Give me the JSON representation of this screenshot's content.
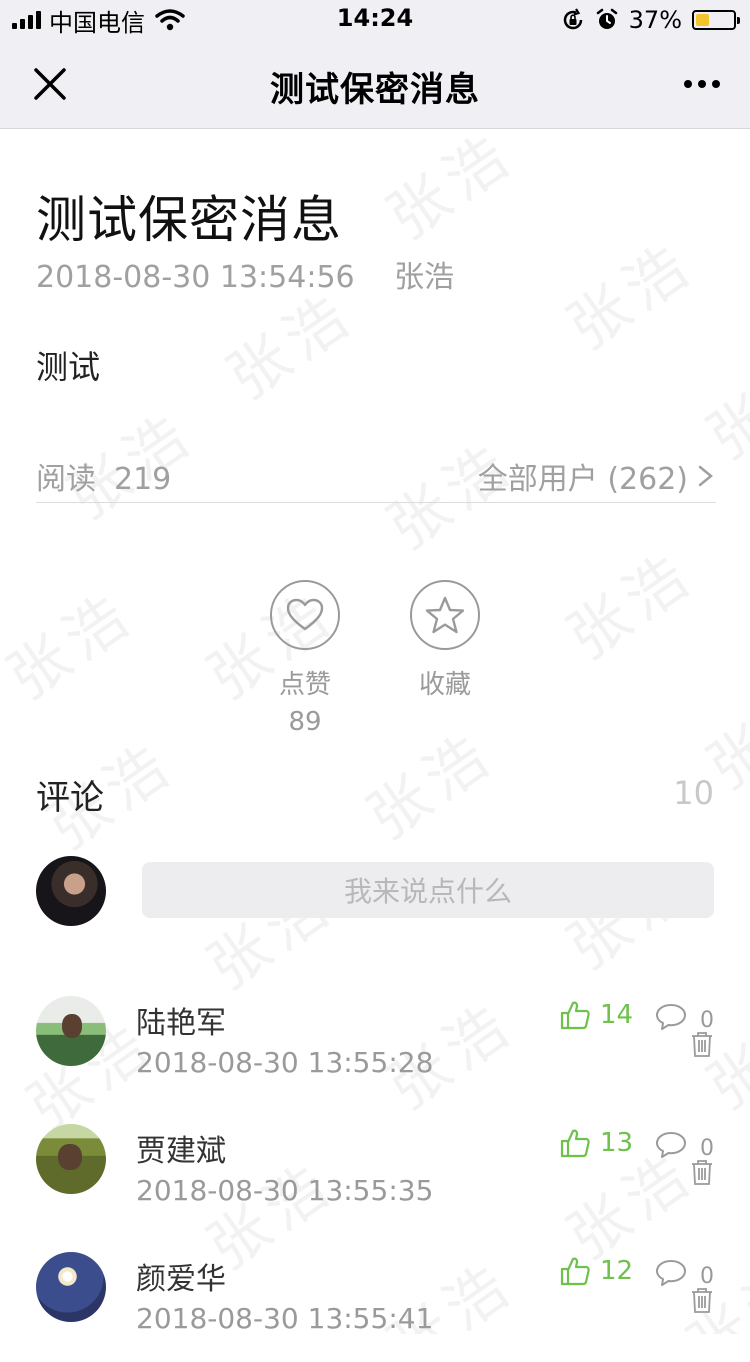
{
  "status_bar": {
    "carrier": "中国电信",
    "time": "14:24",
    "battery_percent": "37%",
    "battery_level": 0.37,
    "battery_color": "#f4c430"
  },
  "nav": {
    "title": "测试保密消息",
    "close_icon": "close-icon",
    "more_icon": "more-icon"
  },
  "watermark": "张浩",
  "article": {
    "title": "测试保密消息",
    "date": "2018-08-30 13:54:56",
    "author": "张浩",
    "body": "测试"
  },
  "read_row": {
    "label": "阅读",
    "count": "219",
    "audience": "全部用户 (262)"
  },
  "actions": {
    "like_label": "点赞",
    "like_count": "89",
    "favorite_label": "收藏"
  },
  "comments": {
    "header": "评论",
    "count": "10",
    "input_placeholder": "我来说点什么",
    "items": [
      {
        "name": "陆艳军",
        "time": "2018-08-30 13:55:28",
        "likes": "14",
        "replies": "0"
      },
      {
        "name": "贾建斌",
        "time": "2018-08-30 13:55:35",
        "likes": "13",
        "replies": "0"
      },
      {
        "name": "颜爱华",
        "time": "2018-08-30 13:55:41",
        "likes": "12",
        "replies": "0"
      }
    ]
  },
  "colors": {
    "accent_green": "#6cc24a",
    "secondary_text": "#a0a0a0",
    "nav_background": "#efeff4"
  }
}
